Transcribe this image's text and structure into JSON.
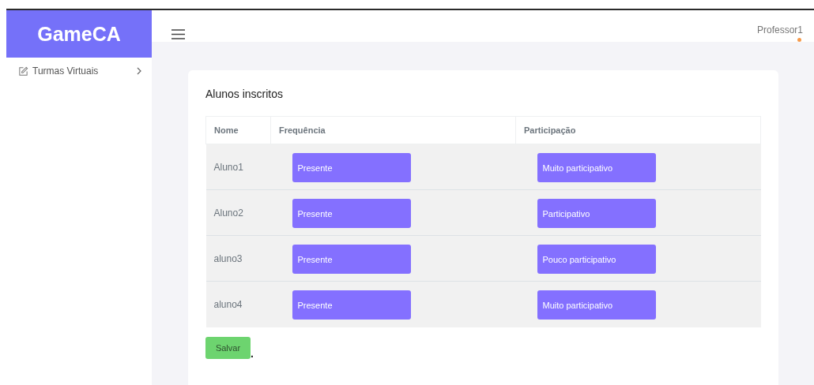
{
  "sidebar": {
    "logo": "GameCA",
    "items": [
      {
        "label": "Turmas Virtuais",
        "expanded": false
      }
    ]
  },
  "header": {
    "user": "Professor1"
  },
  "card": {
    "title": "Alunos inscritos",
    "table": {
      "columns": [
        "Nome",
        "Frequência",
        "Participação"
      ],
      "rows": [
        {
          "name": "Aluno1",
          "frequency": "Presente",
          "participation": "Muito participativo"
        },
        {
          "name": "Aluno2",
          "frequency": "Presente",
          "participation": "Participativo"
        },
        {
          "name": "aluno3",
          "frequency": "Presente",
          "participation": "Pouco participativo"
        },
        {
          "name": "aluno4",
          "frequency": "Presente",
          "participation": "Muito participativo"
        }
      ]
    },
    "save_button": "Salvar",
    "trailing_mark": "."
  }
}
